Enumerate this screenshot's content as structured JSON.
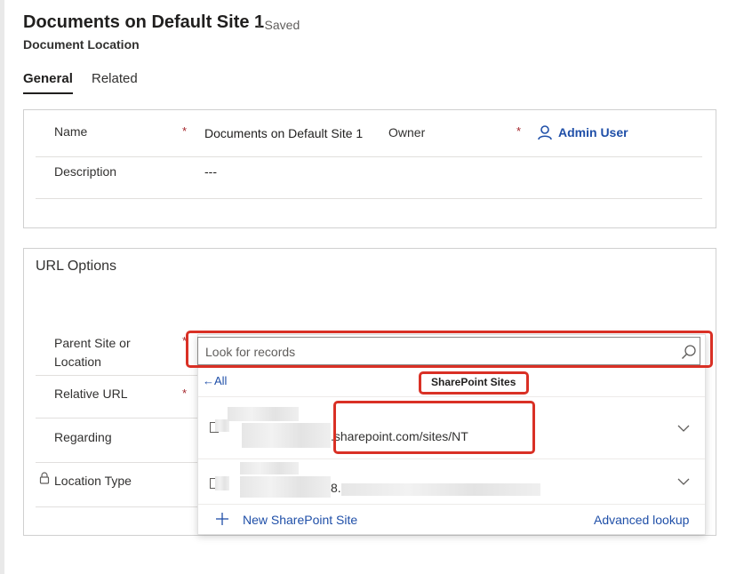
{
  "header": {
    "title": "Documents on Default Site 1",
    "saved_status": "- Saved",
    "entity": "Document Location"
  },
  "tabs": [
    {
      "label": "General",
      "active": true
    },
    {
      "label": "Related",
      "active": false
    }
  ],
  "general_section": {
    "name_label": "Name",
    "name_value": "Documents on Default Site 1",
    "owner_label": "Owner",
    "owner_value": "Admin User",
    "description_label": "Description",
    "description_value": "---",
    "required_marker": "*"
  },
  "url_options": {
    "title": "URL Options",
    "parent_label": "Parent Site or Location",
    "relative_url_label": "Relative URL",
    "regarding_label": "Regarding",
    "location_type_label": "Location Type"
  },
  "lookup": {
    "placeholder": "Look for records",
    "back_label": "All",
    "entity_filter": "SharePoint Sites",
    "results": [
      {
        "url_text": ".sharepoint.com/sites/NT"
      },
      {
        "url_text": "8."
      }
    ],
    "new_label": "New SharePoint Site",
    "advanced_label": "Advanced lookup"
  },
  "colors": {
    "accent": "#1f4fa8",
    "required": "#a4262c",
    "highlight": "#d93025"
  }
}
